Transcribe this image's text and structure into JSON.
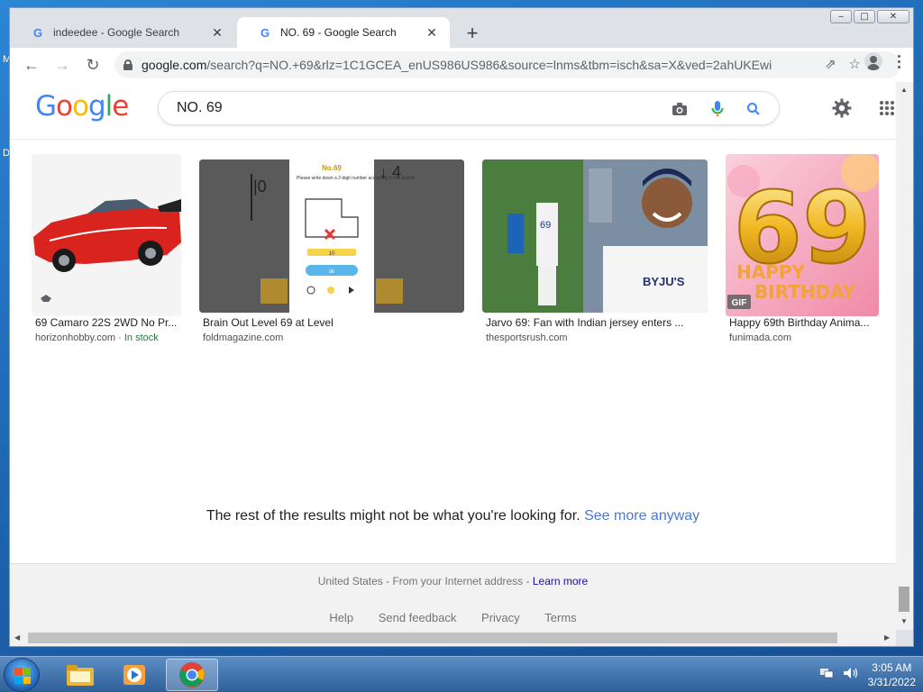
{
  "desktop": {
    "letters": [
      "M",
      "D"
    ]
  },
  "window": {
    "minimize": "‒",
    "maximize": "□",
    "close": "✕"
  },
  "tabs": [
    {
      "title": "indeedee - Google Search",
      "close": "✕"
    },
    {
      "title": "NO. 69 - Google Search",
      "close": "✕"
    }
  ],
  "new_tab": "+",
  "toolbar": {
    "back": "←",
    "forward": "→",
    "reload": "↻",
    "url_domain": "google.com",
    "url_path": "/search?q=NO.+69&rlz=1C1GCEA_enUS986US986&source=lnms&tbm=isch&sa=X&ved=2ahUKEwi...",
    "share": "⇗",
    "bookmark": "☆"
  },
  "google": {
    "logo_letters": [
      "G",
      "o",
      "o",
      "g",
      "l",
      "e"
    ],
    "logo_colors": [
      "#4285f4",
      "#ea4335",
      "#fbbc05",
      "#4285f4",
      "#34a853",
      "#ea4335"
    ],
    "search_value": "NO. 69"
  },
  "results": [
    {
      "title": "69 Camaro 22S 2WD No Pr...",
      "source": "horizonhobby.com",
      "extra": " · ",
      "stock": "In stock"
    },
    {
      "title": "Brain Out Level 69 at Level",
      "source": "foldmagazine.com"
    },
    {
      "title": "Jarvo 69: Fan with Indian jersey enters ...",
      "source": "thesportsrush.com"
    },
    {
      "title": "Happy 69th Birthday Anima...",
      "source": "funimada.com"
    }
  ],
  "thumb_text": {
    "brain_title": "No.69",
    "brain_prompt": "Please write down a 2-digit number according to the picture",
    "brain_answer": "10",
    "brain_button": "ok",
    "jersey_number": "69",
    "byju": "BYJU'S",
    "birthday_number": "69",
    "birthday_happy": "HAPPY",
    "birthday_text": "BIRTHDAY",
    "gif_badge": "GIF"
  },
  "rest_message": {
    "text": "The rest of the results might not be what you're looking for. ",
    "link": "See more anyway"
  },
  "footer": {
    "location": "United States - From your Internet address - ",
    "learn_more": "Learn more",
    "links": [
      "Help",
      "Send feedback",
      "Privacy",
      "Terms"
    ]
  },
  "taskbar": {
    "time": "3:05 AM",
    "date": "3/31/2022"
  }
}
